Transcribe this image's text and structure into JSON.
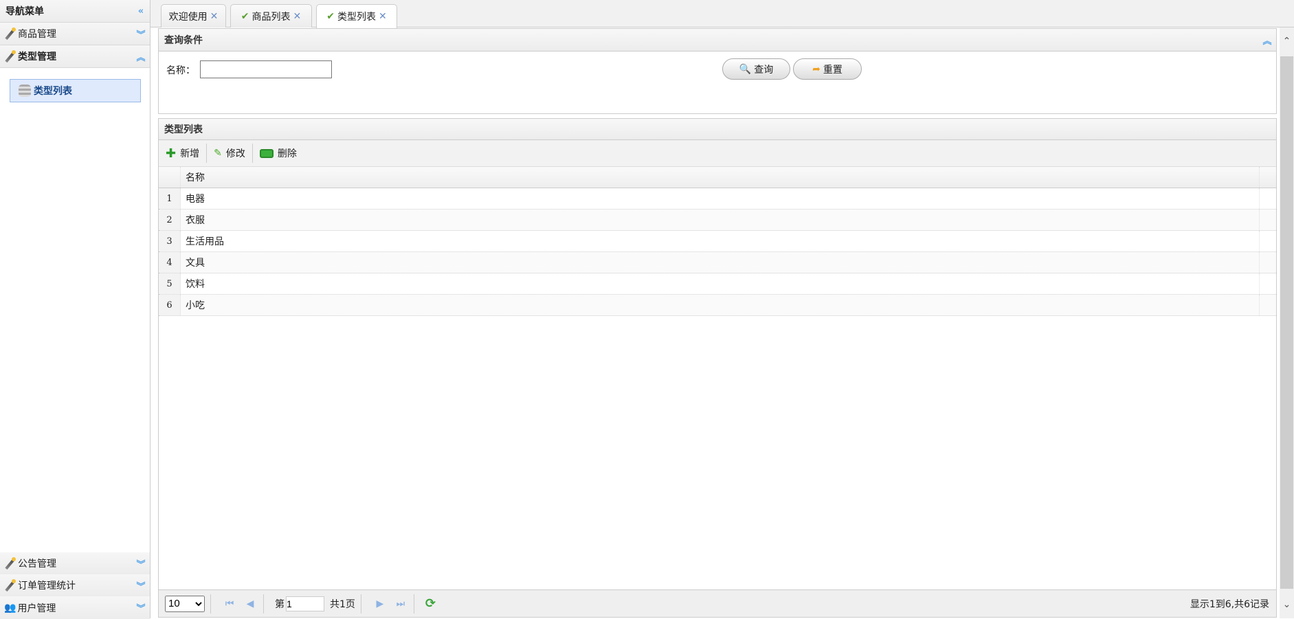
{
  "sidebar": {
    "title": "导航菜单",
    "sections": [
      {
        "label": "商品管理"
      },
      {
        "label": "类型管理"
      },
      {
        "label": "公告管理"
      },
      {
        "label": "订单管理统计"
      },
      {
        "label": "用户管理"
      }
    ],
    "selected_item": "类型列表"
  },
  "tabs": [
    {
      "label": "欢迎使用"
    },
    {
      "label": "商品列表"
    },
    {
      "label": "类型列表"
    }
  ],
  "query": {
    "title": "查询条件",
    "name_label": "名称：",
    "name_value": "",
    "search_label": "查询",
    "reset_label": "重置"
  },
  "list": {
    "title": "类型列表",
    "toolbar": {
      "add": "新增",
      "edit": "修改",
      "delete": "删除"
    },
    "column": "名称",
    "rows": [
      {
        "n": "1",
        "name": "电器"
      },
      {
        "n": "2",
        "name": "衣服"
      },
      {
        "n": "3",
        "name": "生活用品"
      },
      {
        "n": "4",
        "name": "文具"
      },
      {
        "n": "5",
        "name": "饮料"
      },
      {
        "n": "6",
        "name": "小吃"
      }
    ]
  },
  "pager": {
    "page_size": "10",
    "page_prefix": "第",
    "page": "1",
    "page_suffix": "共1页",
    "summary": "显示1到6,共6记录"
  }
}
